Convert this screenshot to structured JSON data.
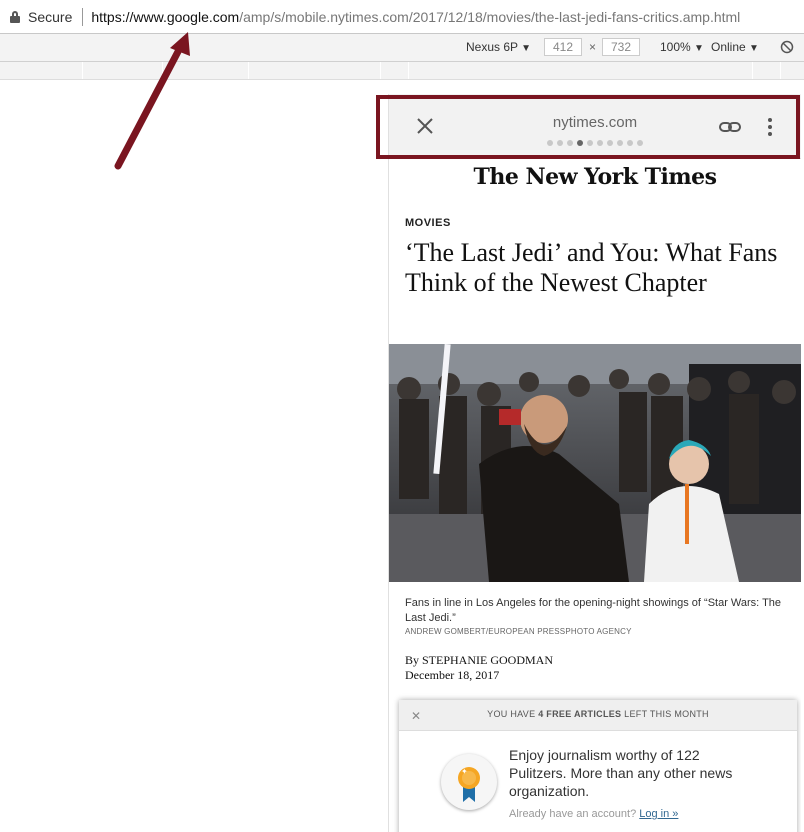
{
  "address_bar": {
    "secure_label": "Secure",
    "url_host": "https://www.google.com",
    "url_rest": "/amp/s/mobile.nytimes.com/2017/12/18/movies/the-last-jedi-fans-critics.amp.html"
  },
  "device_toolbar": {
    "device": "Nexus 6P",
    "width": "412",
    "times": "×",
    "height": "732",
    "zoom": "100%",
    "network": "Online"
  },
  "amp_viewer": {
    "domain": "nytimes.com",
    "highlight_color": "#7a1520"
  },
  "article": {
    "masthead": "The New York Times",
    "section": "MOVIES",
    "headline": "‘The Last Jedi’ and You: What Fans Think of the Newest Chapter",
    "caption": "Fans in line in Los Angeles for the opening-night showings of “Star Wars: The Last Jedi.”",
    "credit": "ANDREW GOMBERT/EUROPEAN PRESSPHOTO AGENCY",
    "byline": "By STEPHANIE GOODMAN",
    "date": "December 18, 2017"
  },
  "paywall": {
    "msg_prefix": "YOU HAVE ",
    "msg_bold": "4 FREE ARTICLES",
    "msg_suffix": " LEFT THIS MONTH",
    "body": "Enjoy journalism worthy of 122 Pulitzers. More than any other news organization.",
    "account_prefix": "Already have an account? ",
    "login_label": "Log in »"
  }
}
